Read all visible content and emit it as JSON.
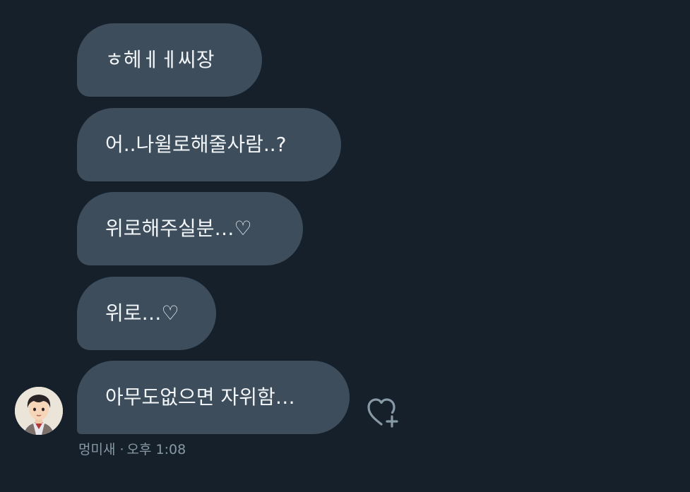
{
  "messages": [
    {
      "text": "ㅎ헤ㅔㅔ씨장"
    },
    {
      "text": "어..나윌로해줄사람..?"
    },
    {
      "text": "위로해주실분…♡"
    },
    {
      "text": "위로…♡"
    },
    {
      "text": "아무도없으면 자위함…"
    }
  ],
  "sender": {
    "name": "멍미새",
    "separator": "·",
    "time": "오후 1:08"
  },
  "icons": {
    "avatar": "avatar-icon",
    "react": "heart-plus-icon"
  },
  "colors": {
    "background": "#15202b",
    "bubble": "#3d4d5c",
    "text": "#f3f6f8",
    "meta": "#8899a6"
  }
}
